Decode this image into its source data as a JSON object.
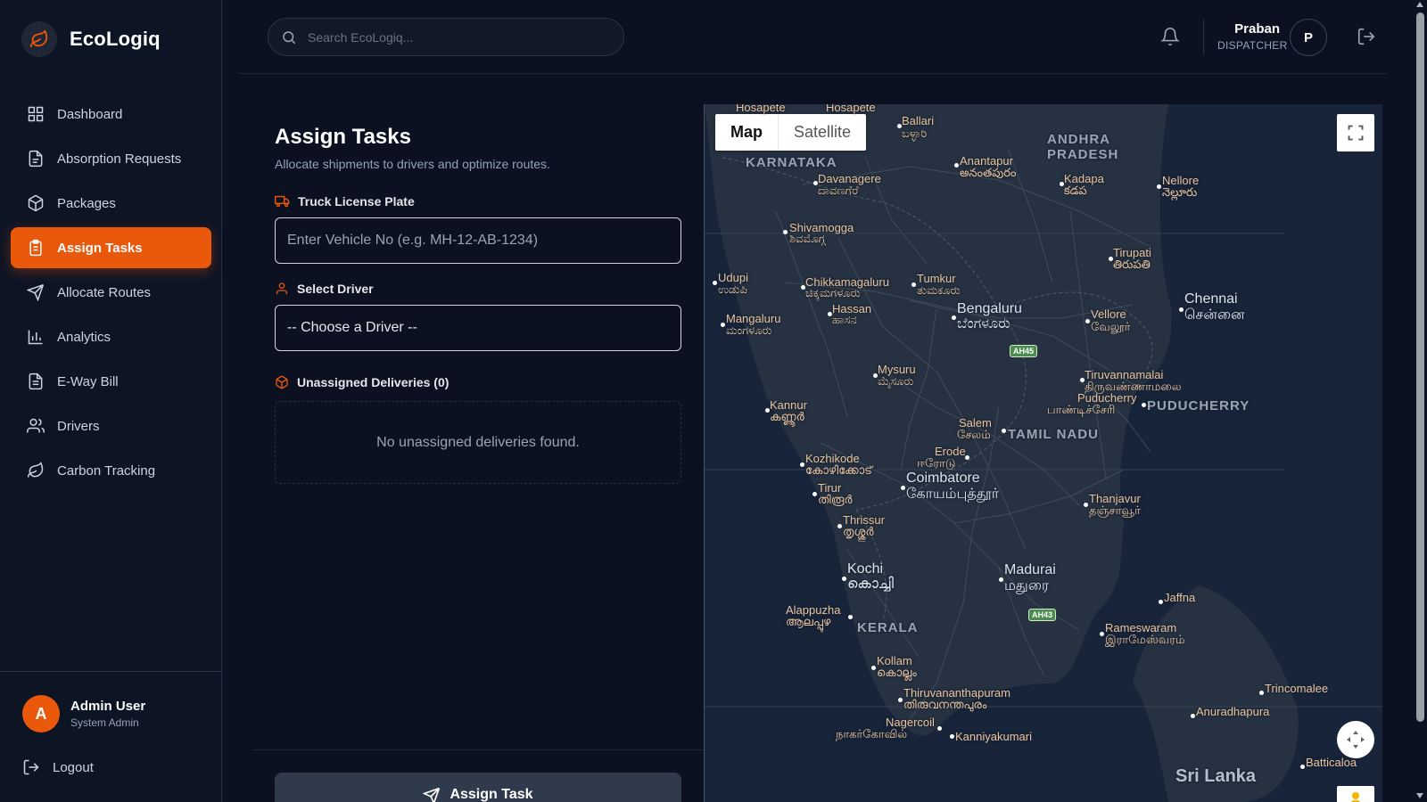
{
  "brand": {
    "name": "EcoLogiq"
  },
  "sidebar": {
    "items": [
      {
        "label": "Dashboard",
        "icon": "dashboard-icon"
      },
      {
        "label": "Absorption Requests",
        "icon": "document-icon"
      },
      {
        "label": "Packages",
        "icon": "package-icon"
      },
      {
        "label": "Assign Tasks",
        "icon": "clipboard-icon",
        "active": true
      },
      {
        "label": "Allocate Routes",
        "icon": "navigation-icon"
      },
      {
        "label": "Analytics",
        "icon": "bar-chart-icon"
      },
      {
        "label": "E-Way Bill",
        "icon": "file-text-icon"
      },
      {
        "label": "Drivers",
        "icon": "users-icon"
      },
      {
        "label": "Carbon Tracking",
        "icon": "leaf-icon"
      }
    ],
    "user": {
      "initial": "A",
      "name": "Admin User",
      "role": "System Admin"
    },
    "logout_label": "Logout"
  },
  "header": {
    "search_placeholder": "Search EcoLogiq...",
    "profile": {
      "name": "Praban",
      "role": "DISPATCHER",
      "initial": "P"
    }
  },
  "main": {
    "title": "Assign Tasks",
    "subtitle": "Allocate shipments to drivers and optimize routes.",
    "truck_label": "Truck License Plate",
    "truck_placeholder": "Enter Vehicle No (e.g. MH-12-AB-1234)",
    "driver_label": "Select Driver",
    "driver_selected": "-- Choose a Driver --",
    "unassigned_label": "Unassigned Deliveries (0)",
    "empty_text": "No unassigned deliveries found.",
    "assign_button": "Assign Task"
  },
  "map": {
    "tabs": [
      "Map",
      "Satellite"
    ],
    "selected_tab": "Map",
    "labels": {
      "ballari": "Ballari",
      "ballari_k": "ಬಳ್ಳಾರಿ",
      "hosapete": "Hosapete",
      "karnataka": "KARNATAKA",
      "andhra": "ANDHRA",
      "pradesh": "PRADESH",
      "davanagere": "Davanagere",
      "davanagere_k": "ದಾವಣಗೆರೆ",
      "anantapur": "Anantapur",
      "anantapur_t": "అనంతపురం",
      "kadapa": "Kadapa",
      "kadapa_t": "కడప",
      "nellore": "Nellore",
      "nellore_t": "నెల్లూరు",
      "shivamogga": "Shivamogga",
      "shivamogga_k": "ಶಿವಮೊಗ್ಗ",
      "tirupati": "Tirupati",
      "tirupati_t": "తిరుపతి",
      "udupi": "Udupi",
      "udupi_k": "ಉಡುಪಿ",
      "chikkamagaluru": "Chikkamagaluru",
      "chikkamagaluru_k": "ಚಿಕ್ಕಮಗಳೂರು",
      "tumkur": "Tumkur",
      "tumkur_k": "ತುಮಕೂರು",
      "chennai": "Chennai",
      "chennai_ta": "சென்னை",
      "bengaluru": "Bengaluru",
      "bengaluru_k": "ಬೆಂಗಳೂರು",
      "hassan": "Hassan",
      "hassan_k": "ಹಾಸನ",
      "mangaluru": "Mangaluru",
      "mangaluru_k": "ಮಂಗಳೂರು",
      "vellore": "Vellore",
      "vellore_ta": "வேலூர்",
      "mysuru": "Mysuru",
      "mysuru_k": "ಮೈಸೂರು",
      "tiruvannamalai": "Tiruvannamalai",
      "tiruvannamalai_ta": "திருவண்ணாமலை",
      "puducherry": "Puducherry",
      "puducherry_ta": "பாண்டிச்சேரி",
      "puducherry_state": "PUDUCHERRY",
      "kannur": "Kannur",
      "kannur_m": "കണ്ണൂർ",
      "salem": "Salem",
      "salem_ta": "சேலம்",
      "tamil_nadu": "TAMIL NADU",
      "erode": "Erode",
      "erode_ta": "ஈரோடு",
      "kozhikode": "Kozhikode",
      "kozhikode_m": "കോഴിക്കോട്",
      "coimbatore": "Coimbatore",
      "coimbatore_ta": "கோயம்புத்தூர்",
      "tirur": "Tirur",
      "tirur_m": "തിരൂർ",
      "thanjavur": "Thanjavur",
      "thanjavur_ta": "தஞ்சாவூர்",
      "thrissur": "Thrissur",
      "thrissur_m": "തൃശ്ശൂർ",
      "kochi": "Kochi",
      "kochi_m": "കൊച്ചി",
      "madurai": "Madurai",
      "madurai_ta": "மதுரை",
      "jaffna": "Jaffna",
      "alappuzha": "Alappuzha",
      "alappuzha_m": "ആലപ്പുഴ",
      "kerala": "KERALA",
      "rameswaram": "Rameswaram",
      "rameswaram_ta": "இராமேஸ்வரம்",
      "kollam": "Kollam",
      "kollam_m": "കൊല്ലം",
      "thiruvananthapuram": "Thiruvananthapuram",
      "thiruvananthapuram_m": "തിരുവനന്തപുരം",
      "trincomalee": "Trincomalee",
      "anuradhapura": "Anuradhapura",
      "nagercoil": "Nagercoil",
      "nagercoil_ta": "நாகர்கோவில்",
      "kanniyakumari": "Kanniyakumari",
      "batticaloa": "Batticaloa",
      "sri_lanka": "Sri Lanka",
      "ah45": "AH45",
      "ah43": "AH43"
    }
  },
  "colors": {
    "accent": "#ea580c",
    "background": "#0b1120",
    "sidebar": "#0d1424"
  }
}
